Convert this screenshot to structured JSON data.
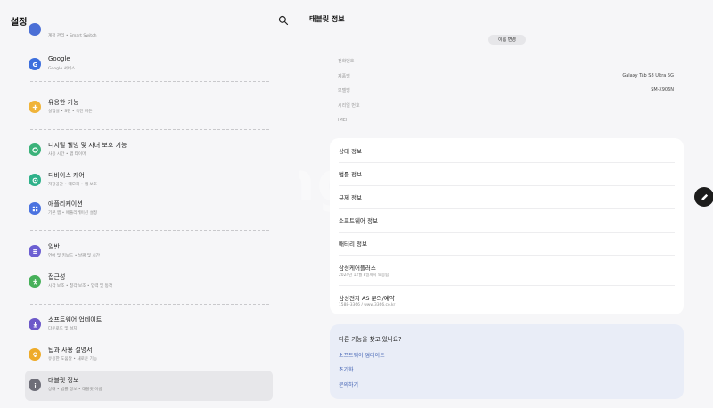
{
  "left": {
    "title": "설정",
    "items": [
      {
        "title": "",
        "subtitle": "계정 관리 • Smart Switch",
        "color": "#4b6fd6"
      },
      {
        "title": "Google",
        "subtitle": "Google 서비스",
        "color": "#3d6fdd"
      },
      {
        "title": "유용한 기능",
        "subtitle": "실험실 • S펜 • 측면 버튼",
        "color": "#f0b43a"
      },
      {
        "title": "디지털 웰빙 및 자녀 보호 기능",
        "subtitle": "사용 시간 • 앱 타이머",
        "color": "#3bb27a"
      },
      {
        "title": "디바이스 케어",
        "subtitle": "저장공간 • 메모리 • 앱 보호",
        "color": "#2fb18a"
      },
      {
        "title": "애플리케이션",
        "subtitle": "기본 앱 • 애플리케이션 설정",
        "color": "#4b73e0"
      },
      {
        "title": "일반",
        "subtitle": "언어 및 키보드 • 날짜 및 시간",
        "color": "#6c5fd2"
      },
      {
        "title": "접근성",
        "subtitle": "시각 보조 • 청각 보조 • 입력 및 동작",
        "color": "#47b05a"
      },
      {
        "title": "소프트웨어 업데이트",
        "subtitle": "다운로드 및 설치",
        "color": "#6d59c9"
      },
      {
        "title": "팁과 사용 설명서",
        "subtitle": "유용한 도움말 • 새로운 기능",
        "color": "#eeab2a"
      },
      {
        "title": "태블릿 정보",
        "subtitle": "상태 • 법률 정보 • 태블릿 이름",
        "color": "#6e6e78"
      }
    ]
  },
  "right": {
    "title": "태블릿 정보",
    "rename_label": "이름 변경",
    "info": [
      {
        "label": "전화번호",
        "value": ""
      },
      {
        "label": "제품명",
        "value": "Galaxy Tab S8 Ultra 5G"
      },
      {
        "label": "모델명",
        "value": "SM-X906N"
      },
      {
        "label": "시리얼 번호",
        "value": ""
      },
      {
        "label": "IMEI",
        "value": ""
      }
    ],
    "menu": [
      {
        "title": "상태 정보",
        "subtitle": ""
      },
      {
        "title": "법률 정보",
        "subtitle": ""
      },
      {
        "title": "규제 정보",
        "subtitle": ""
      },
      {
        "title": "소프트웨어 정보",
        "subtitle": ""
      },
      {
        "title": "배터리 정보",
        "subtitle": ""
      },
      {
        "title": "삼성케어플러스",
        "subtitle": "2024년 12월 8일까지 보증됨"
      },
      {
        "title": "삼성전자 AS 문의/예약",
        "subtitle": "1588-3366 / www.3366.co.kr"
      }
    ],
    "find": {
      "title": "다른 기능을 찾고 있나요?",
      "links": [
        "소프트웨어 업데이트",
        "초기화",
        "문의하기"
      ]
    }
  },
  "watermark": "Joongonara"
}
